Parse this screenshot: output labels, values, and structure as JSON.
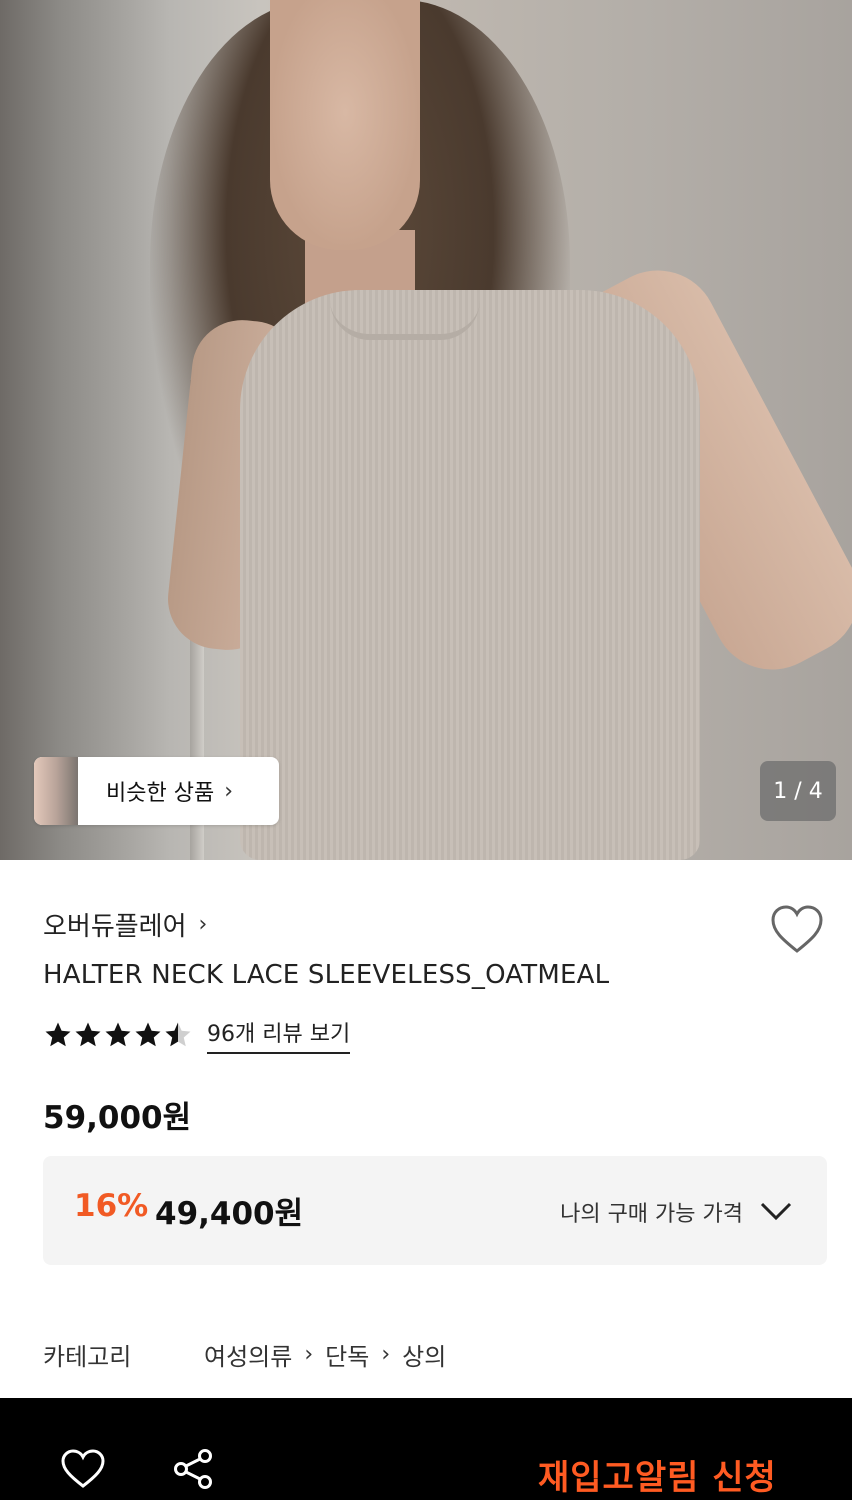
{
  "gallery": {
    "similar_label": "비슷한 상품",
    "counter": "1 / 4",
    "current_index": 1,
    "total": 4
  },
  "product": {
    "brand": "오버듀플레어",
    "name": "HALTER NECK LACE SLEEVELESS_OATMEAL",
    "rating": 4.5,
    "review_link": "96개 리뷰 보기",
    "price": "59,000원",
    "discount_percent": "16%",
    "discount_price": "49,400원",
    "buy_price_label": "나의 구매 가능 가격"
  },
  "category": {
    "label": "카테고리",
    "path": [
      "여성의류",
      "단독",
      "상의"
    ]
  },
  "bottom_bar": {
    "restock_label": "재입고알림 신청",
    "icons": [
      "heart-icon",
      "share-icon"
    ]
  },
  "colors": {
    "accent": "#f15a24",
    "restock": "#ff5b22",
    "bottom_bar_bg": "#000000",
    "discount_box_bg": "#f4f4f4"
  }
}
